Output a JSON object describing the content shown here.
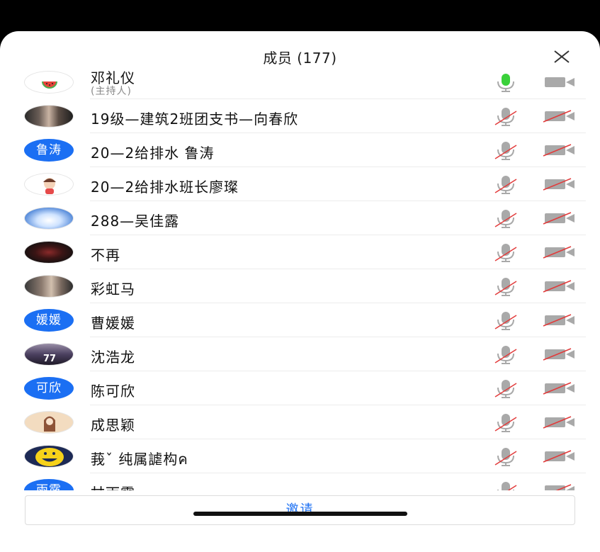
{
  "header": {
    "title": "成员 (177)"
  },
  "host": {
    "name": "邓礼仪",
    "role": "(主持人)",
    "avatar": "watermelon-avatar",
    "mic": "on",
    "camera": "off"
  },
  "members": [
    {
      "name": "19级—建筑2班团支书—向春欣",
      "avatar_type": "photo",
      "avatar": "girl-portrait-avatar"
    },
    {
      "name": "20—2给排水 鲁涛",
      "avatar_type": "text",
      "avatar_text": "鲁涛"
    },
    {
      "name": "20—2给排水班长廖璨",
      "avatar_type": "photo",
      "avatar": "cartoon-girl-avatar"
    },
    {
      "name": "288—吴佳露",
      "avatar_type": "photo",
      "avatar": "sky-clouds-avatar"
    },
    {
      "name": "不再",
      "avatar_type": "photo",
      "avatar": "dark-figure-avatar"
    },
    {
      "name": "彩虹马",
      "avatar_type": "photo",
      "avatar": "woman-photo-avatar"
    },
    {
      "name": "曹媛媛",
      "avatar_type": "text",
      "avatar_text": "媛媛"
    },
    {
      "name": "沈浩龙",
      "avatar_type": "photo",
      "avatar": "jersey-77-avatar"
    },
    {
      "name": "陈可欣",
      "avatar_type": "text",
      "avatar_text": "可欣"
    },
    {
      "name": "成思颖",
      "avatar_type": "photo",
      "avatar": "illustrated-girl-avatar"
    },
    {
      "name": "莪ˇ 纯属謔构ค",
      "avatar_type": "photo",
      "avatar": "yellow-cartoon-avatar"
    },
    {
      "name": "甘雨露",
      "avatar_type": "text",
      "avatar_text": "雨露"
    }
  ],
  "invite_button": {
    "label": "邀请"
  },
  "colors": {
    "accent": "#1b6ff3",
    "mic_on": "#3ad13a",
    "muted_slash": "#e23b3b",
    "icon_gray": "#a9a9a9"
  }
}
